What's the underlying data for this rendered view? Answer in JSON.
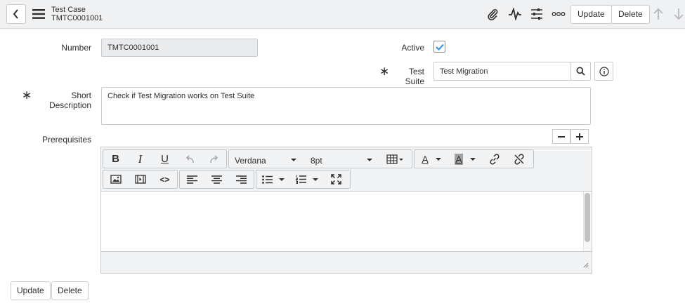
{
  "header": {
    "record_type": "Test Case",
    "record_number": "TMTC0001001",
    "update_label": "Update",
    "delete_label": "Delete"
  },
  "form": {
    "number_label": "Number",
    "number_value": "TMTC0001001",
    "active_label": "Active",
    "active_checked": true,
    "test_suite_label": "Test Suite",
    "test_suite_value": "Test Migration",
    "short_description_label": "Short Description",
    "short_description_value": "Check if Test Migration works on Test Suite",
    "prerequisites_label": "Prerequisites",
    "required_marker": "∗"
  },
  "editor": {
    "font_family": "Verdana",
    "font_size": "8pt",
    "bold_glyph": "B",
    "italic_glyph": "I",
    "underline_glyph": "U",
    "text_color_glyph": "A",
    "bg_color_glyph": "A",
    "code_glyph": "<>"
  },
  "footer": {
    "update_label": "Update",
    "delete_label": "Delete"
  },
  "colors": {
    "header_bg": "#f0f1f2",
    "readonly_bg": "#e9ebed",
    "check_color": "#278efc"
  }
}
